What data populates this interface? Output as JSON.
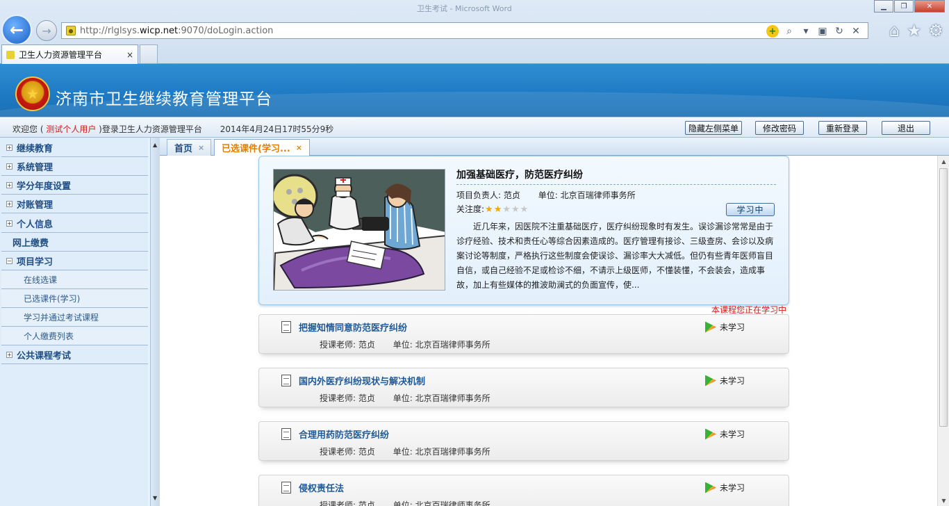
{
  "browser": {
    "window_title_ghost": "卫生考试 - Microsoft Word",
    "url_prefix": "http://rlglsys.",
    "url_domain": "wicp.net",
    "url_suffix": ":9070/doLogin.action",
    "tab_title": "卫生人力资源管理平台",
    "tab_close": "×"
  },
  "header": {
    "title": "济南市卫生继续教育管理平台"
  },
  "welcome": {
    "prefix": "欢迎您 (",
    "user": "测试个人用户",
    "suffix": ")登录卫生人力资源管理平台",
    "datetime": "2014年4月24日17时55分9秒"
  },
  "top_buttons": {
    "hide_menu": "隐藏左侧菜单",
    "change_password": "修改密码",
    "relogin": "重新登录",
    "logout": "退出"
  },
  "sidebar": {
    "items": [
      {
        "label": "继续教育",
        "toggle": "+"
      },
      {
        "label": "系统管理",
        "toggle": "+"
      },
      {
        "label": "学分年度设置",
        "toggle": "+"
      },
      {
        "label": "对账管理",
        "toggle": "+"
      },
      {
        "label": "个人信息",
        "toggle": "+"
      },
      {
        "label": "网上缴费",
        "toggle": ""
      },
      {
        "label": "项目学习",
        "toggle": "−"
      },
      {
        "label": "公共课程考试",
        "toggle": "+"
      }
    ],
    "sub_items": [
      "在线选课",
      "已选课件(学习)",
      "学习并通过考试课程",
      "个人缴费列表"
    ]
  },
  "content_tabs": {
    "home": "首页",
    "active": "已选课件(学习...",
    "close": "×"
  },
  "featured": {
    "title": "加强基础医疗，防范医疗纠纷",
    "leader_label": "项目负责人:",
    "leader": "范贞",
    "unit_label": "单位:",
    "unit": "北京百瑞律师事务所",
    "rating_label": "关注度:",
    "rating": 2,
    "rating_max": 5,
    "status_button": "学习中",
    "description": "近几年来，因医院不注重基础医疗，医疗纠纷现象时有发生。误诊漏诊常常是由于诊疗经验、技术和责任心等综合因素造成的。医疗管理有接诊、三级查房、会诊以及病案讨论等制度，严格执行这些制度会使误诊、漏诊率大大减低。但仍有些青年医师盲目自信，或自己经验不足或检诊不细，不请示上级医师，不懂装懂，不会装会，造成事故，加上有些媒体的推波助澜式的负面宣传，使...",
    "note": "本课程您正在学习中"
  },
  "courses": [
    {
      "title": "把握知情同意防范医疗纠纷",
      "teacher_label": "授课老师:",
      "teacher": "范贞",
      "unit_label": "单位:",
      "unit": "北京百瑞律师事务所",
      "status": "未学习"
    },
    {
      "title": "国内外医疗纠纷现状与解决机制",
      "teacher_label": "授课老师:",
      "teacher": "范贞",
      "unit_label": "单位:",
      "unit": "北京百瑞律师事务所",
      "status": "未学习"
    },
    {
      "title": "合理用药防范医疗纠纷",
      "teacher_label": "授课老师:",
      "teacher": "范贞",
      "unit_label": "单位:",
      "unit": "北京百瑞律师事务所",
      "status": "未学习"
    },
    {
      "title": "侵权责任法",
      "teacher_label": "授课老师:",
      "teacher": "范贞",
      "unit_label": "单位:",
      "unit": "北京百瑞律师事务所",
      "status": "未学习"
    }
  ],
  "colors": {
    "header_blue": "#1f7bc4",
    "user_red": "#d61a1a",
    "active_tab_orange": "#e67e00",
    "course_title_blue": "#1f5a9a"
  }
}
